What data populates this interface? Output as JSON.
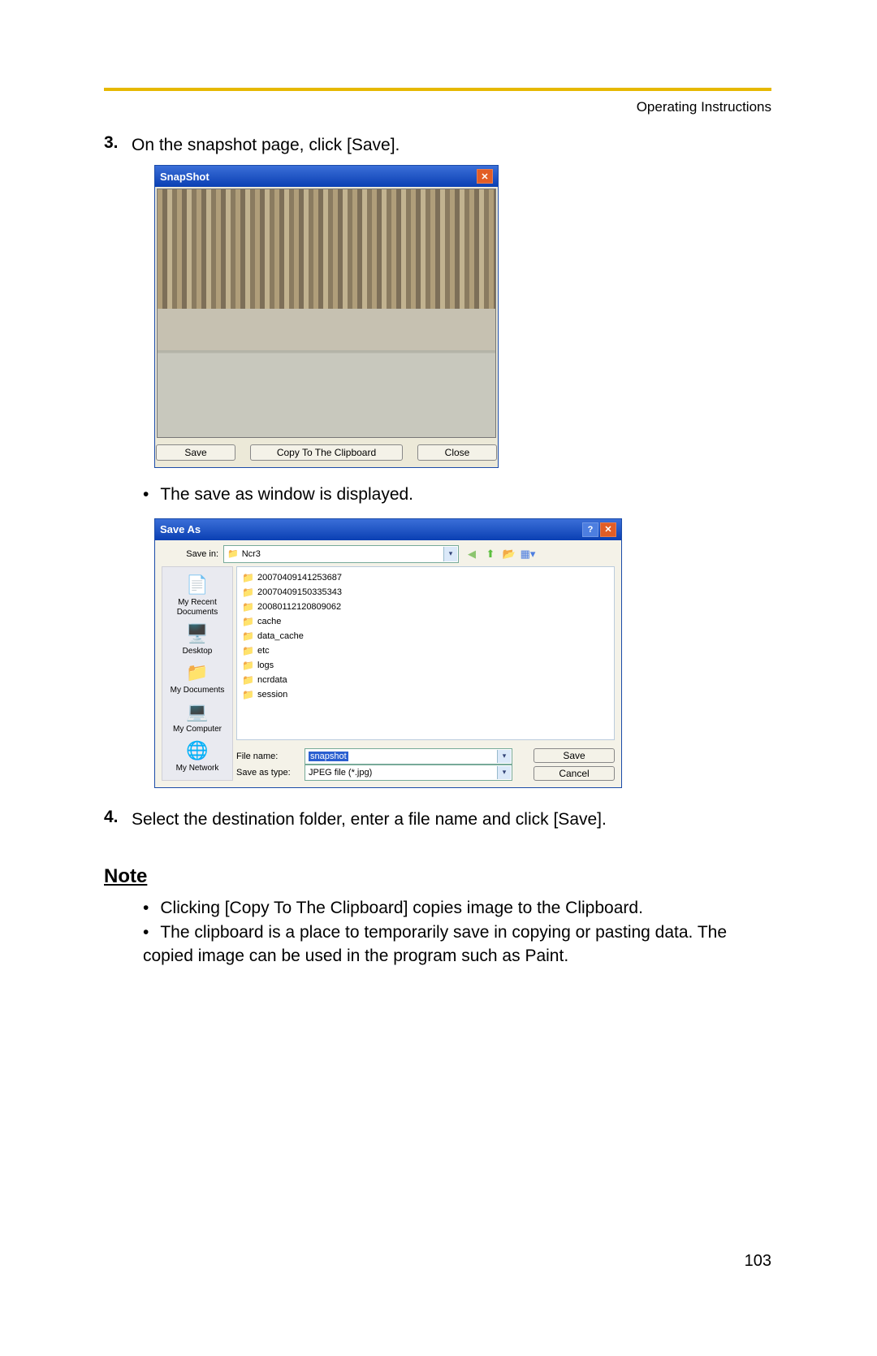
{
  "header": "Operating Instructions",
  "page_number": "103",
  "steps": {
    "s3_num": "3.",
    "s3_text": "On the snapshot page, click [Save].",
    "s3_sub": "The save as window is displayed.",
    "s4_num": "4.",
    "s4_text": "Select the destination folder, enter a file name and click [Save]."
  },
  "note": {
    "heading": "Note",
    "n1": "Clicking [Copy To The Clipboard] copies image to the Clipboard.",
    "n2": "The clipboard is a place to temporarily save in copying or pasting data. The copied image can be used in the program such as Paint."
  },
  "snapshot": {
    "title": "SnapShot",
    "btn_save": "Save",
    "btn_copy": "Copy To The Clipboard",
    "btn_close": "Close"
  },
  "saveas": {
    "title": "Save As",
    "savein_lbl": "Save in:",
    "savein_val": "Ncr3",
    "places": {
      "recent": "My Recent Documents",
      "desktop": "Desktop",
      "mydocs": "My Documents",
      "mycomp": "My Computer",
      "mynet": "My Network"
    },
    "files": [
      "20070409141253687",
      "20070409150335343",
      "20080112120809062",
      "cache",
      "data_cache",
      "etc",
      "logs",
      "ncrdata",
      "session"
    ],
    "filename_lbl": "File name:",
    "filename_val": "snapshot",
    "type_lbl": "Save as type:",
    "type_val": "JPEG file (*.jpg)",
    "btn_save": "Save",
    "btn_cancel": "Cancel"
  }
}
